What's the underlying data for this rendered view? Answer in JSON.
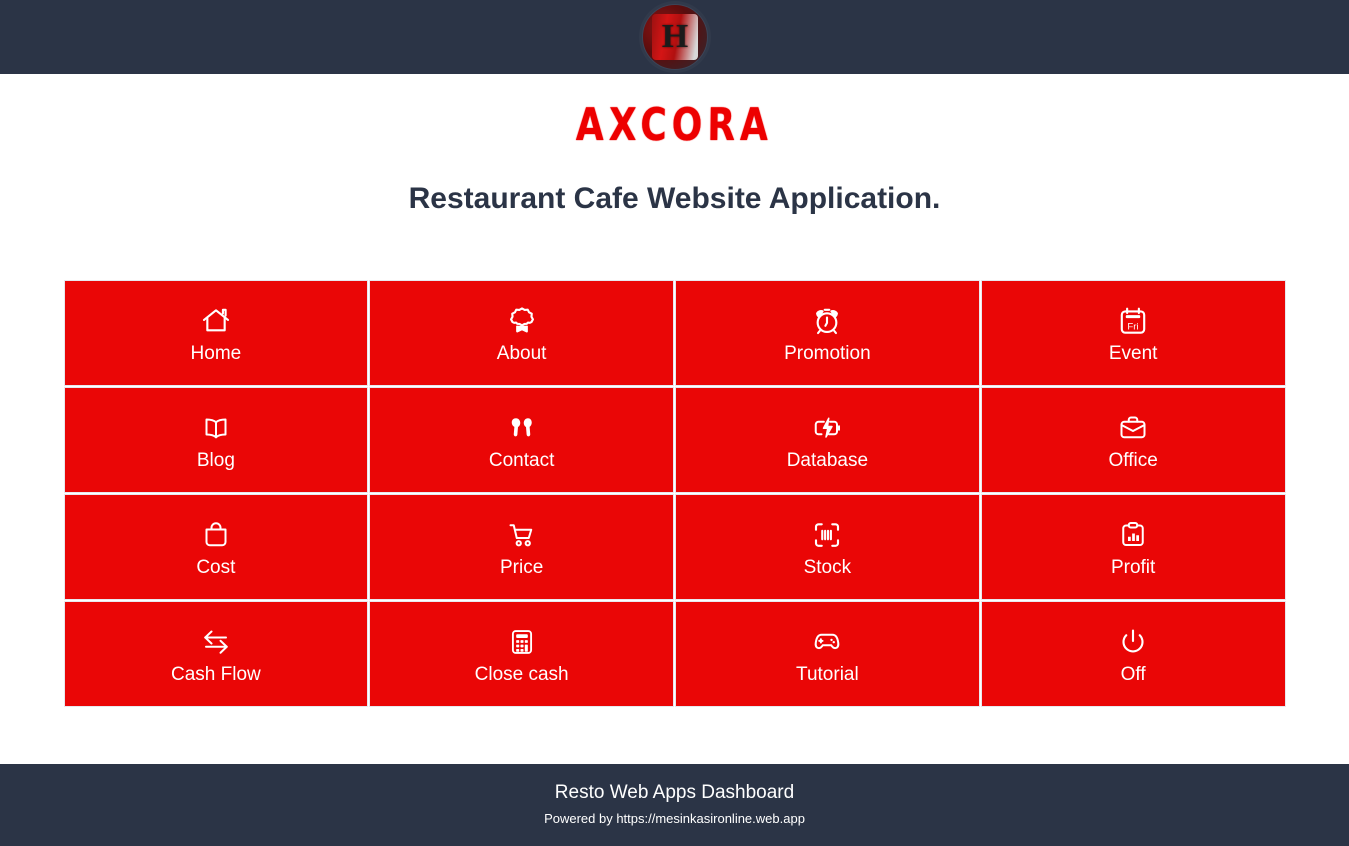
{
  "topbar": {
    "logo_name": "app-logo",
    "logo_glyph": "H"
  },
  "header": {
    "brand": "AXCORA",
    "headline": "Restaurant Cafe Website Application."
  },
  "colors": {
    "tile_red": "#ea0606",
    "brand_red": "#ed0000",
    "navy": "#2b3446"
  },
  "tiles": [
    {
      "label": "Home",
      "icon": "house-icon"
    },
    {
      "label": "About",
      "icon": "award-badge-icon"
    },
    {
      "label": "Promotion",
      "icon": "alarm-clock-icon"
    },
    {
      "label": "Event",
      "icon": "calendar-icon",
      "icon_text": "Fri"
    },
    {
      "label": "Blog",
      "icon": "open-book-icon"
    },
    {
      "label": "Contact",
      "icon": "earbuds-icon"
    },
    {
      "label": "Database",
      "icon": "battery-charging-icon"
    },
    {
      "label": "Office",
      "icon": "briefcase-icon"
    },
    {
      "label": "Cost",
      "icon": "shopping-bag-icon"
    },
    {
      "label": "Price",
      "icon": "shopping-cart-icon"
    },
    {
      "label": "Stock",
      "icon": "barcode-scanner-icon"
    },
    {
      "label": "Profit",
      "icon": "clipboard-chart-icon"
    },
    {
      "label": "Cash Flow",
      "icon": "exchange-arrows-icon"
    },
    {
      "label": "Close cash",
      "icon": "calculator-icon"
    },
    {
      "label": "Tutorial",
      "icon": "game-controller-icon"
    },
    {
      "label": "Off",
      "icon": "power-icon"
    }
  ],
  "footer": {
    "title": "Resto Web Apps Dashboard",
    "subtitle": "Powered by https://mesinkasironline.web.app"
  }
}
